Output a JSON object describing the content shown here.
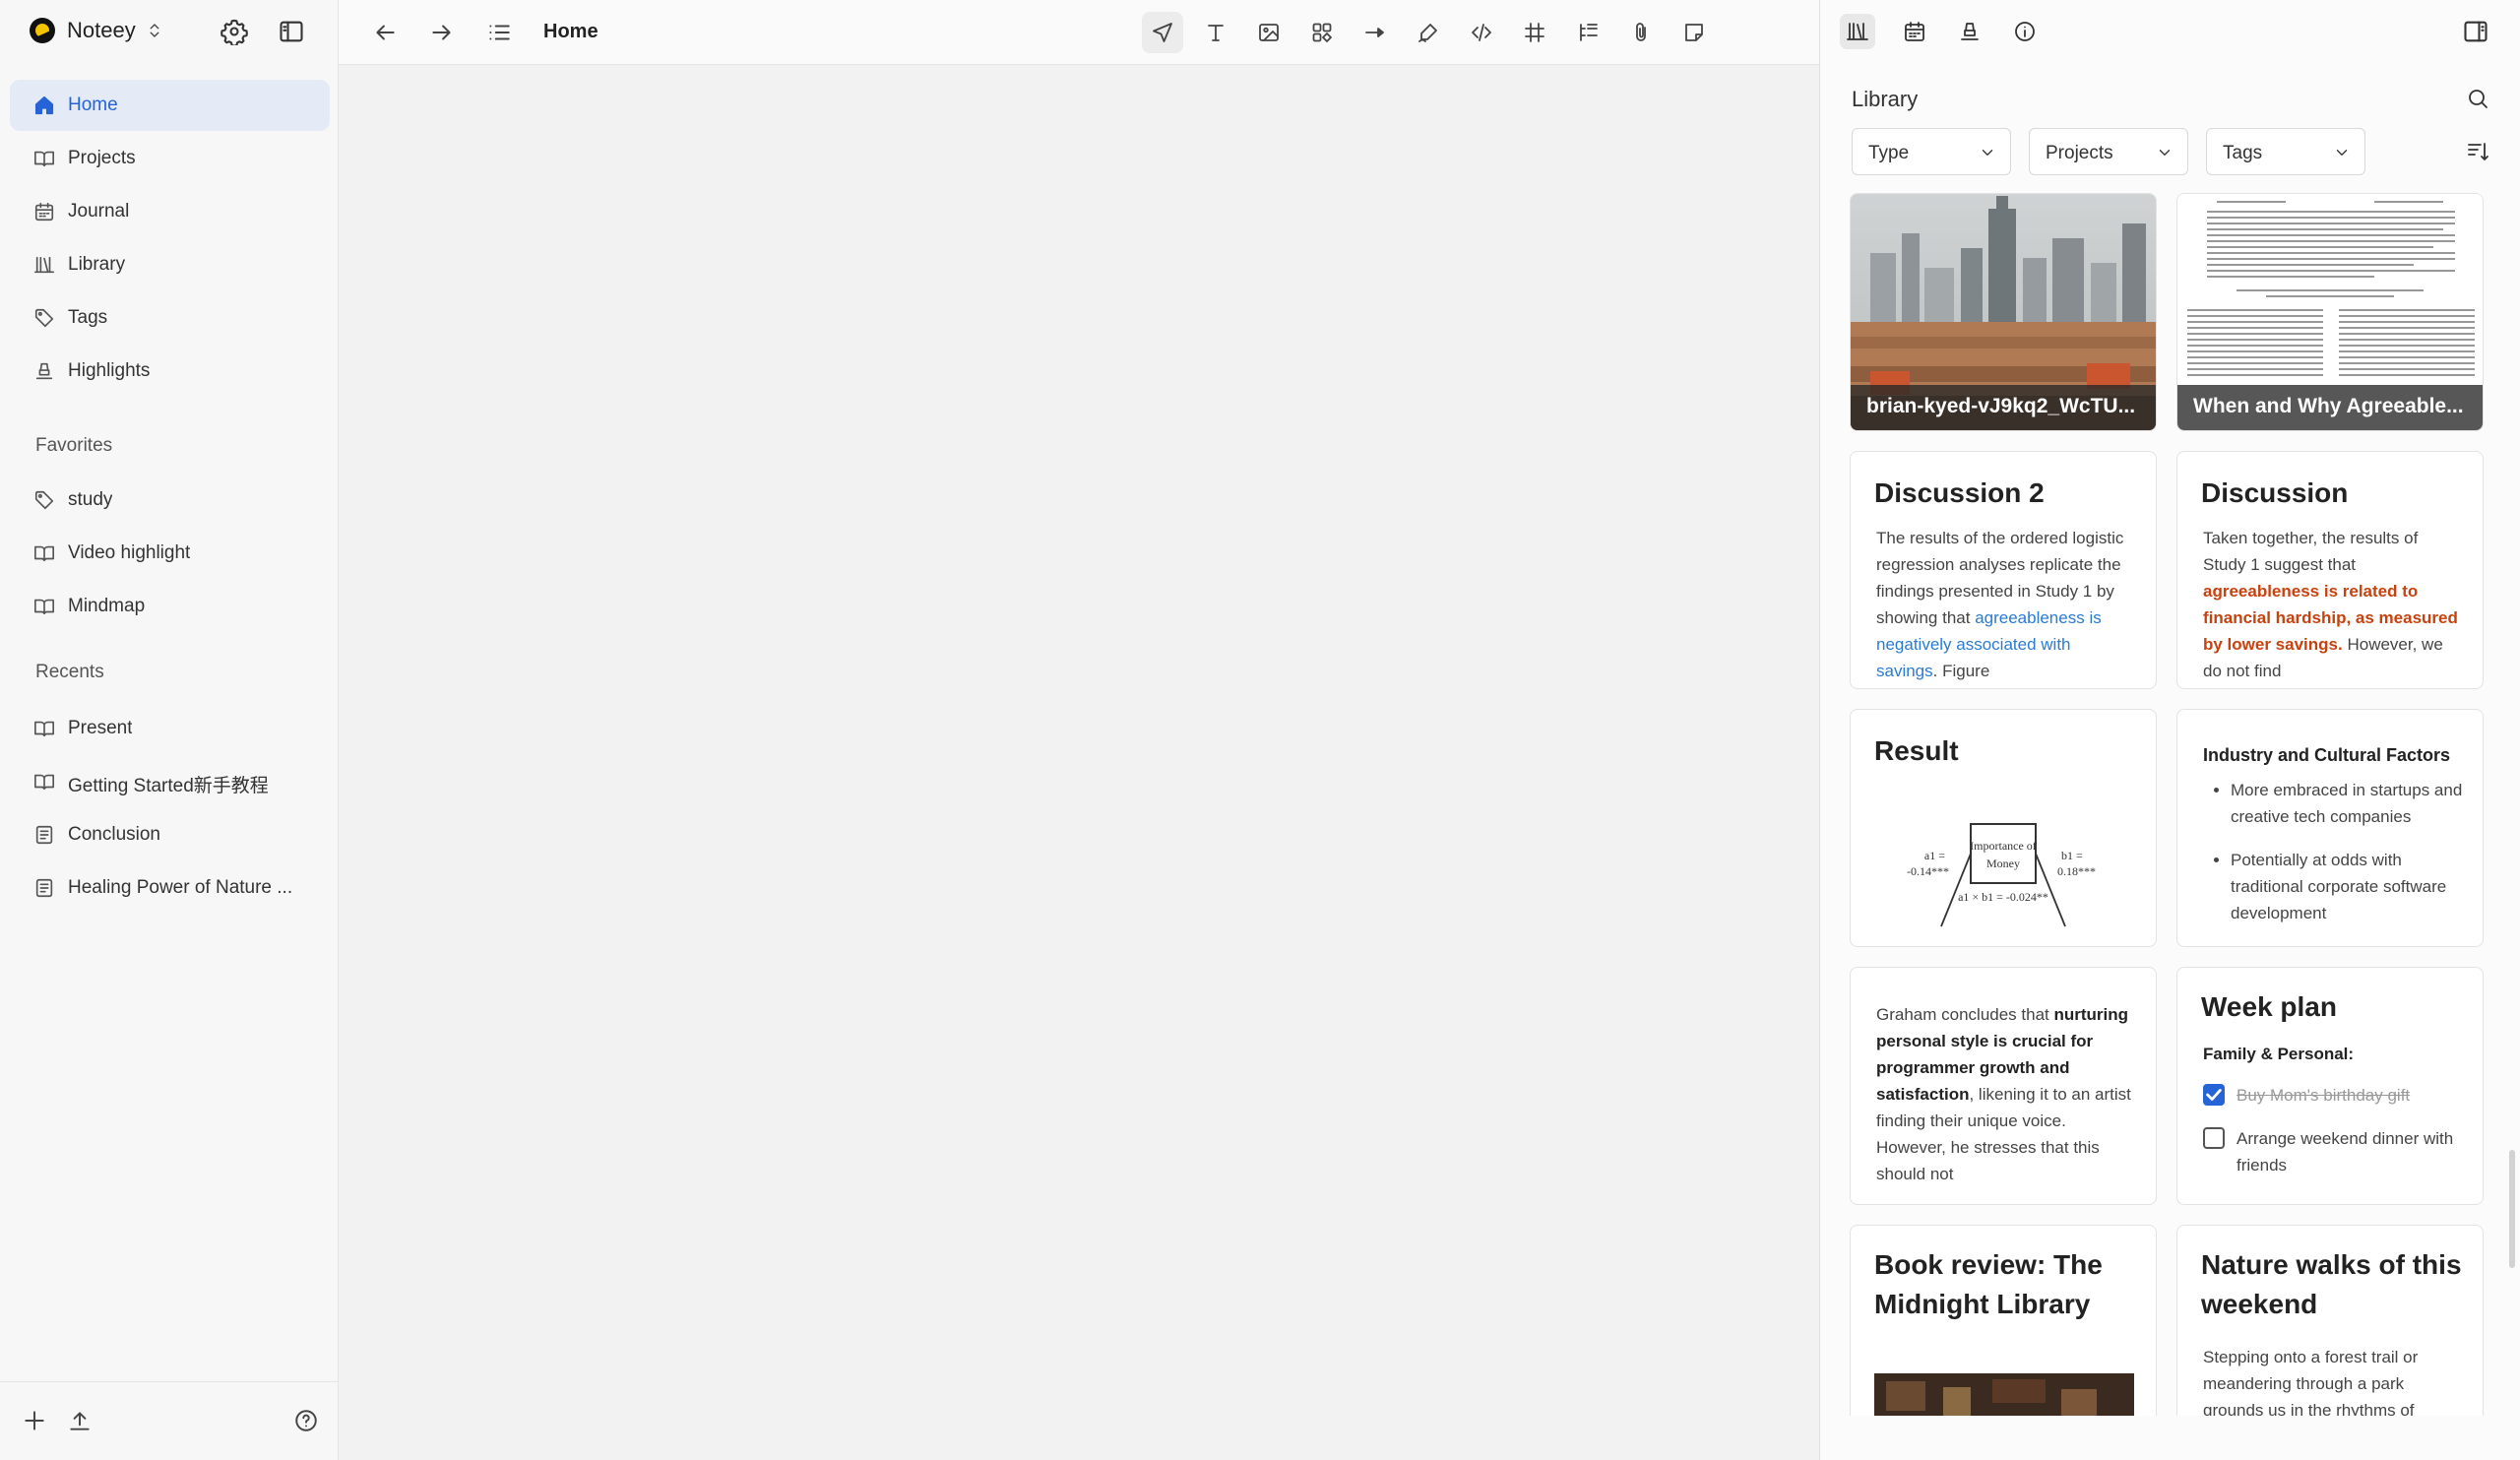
{
  "app": {
    "name": "Noteey"
  },
  "sidebar": {
    "nav": [
      {
        "label": "Home",
        "icon": "home-icon",
        "active": true
      },
      {
        "label": "Projects",
        "icon": "book-icon"
      },
      {
        "label": "Journal",
        "icon": "calendar-icon"
      },
      {
        "label": "Library",
        "icon": "library-icon"
      },
      {
        "label": "Tags",
        "icon": "tag-icon"
      },
      {
        "label": "Highlights",
        "icon": "highlighter-icon"
      }
    ],
    "favorites_title": "Favorites",
    "favorites": [
      {
        "label": "study",
        "icon": "tag-icon"
      },
      {
        "label": "Video highlight",
        "icon": "book-icon"
      },
      {
        "label": "Mindmap",
        "icon": "book-icon"
      }
    ],
    "recents_title": "Recents",
    "recents": [
      {
        "label": "Present",
        "icon": "book-icon"
      },
      {
        "label": "Getting Started新手教程",
        "icon": "book-icon"
      },
      {
        "label": "Conclusion",
        "icon": "note-icon"
      },
      {
        "label": "Healing Power of Nature ...",
        "icon": "note-icon"
      }
    ]
  },
  "main": {
    "breadcrumb": "Home",
    "toolbar": [
      "pointer-icon",
      "text-icon",
      "image-icon",
      "shapes-icon",
      "arrow-icon",
      "pen-icon",
      "code-icon",
      "frame-icon",
      "outline-icon",
      "attach-icon",
      "sticky-note-icon"
    ]
  },
  "panel": {
    "title": "Library",
    "filters": {
      "type": "Type",
      "projects": "Projects",
      "tags": "Tags"
    },
    "cards": {
      "img1": {
        "title": "brian-kyed-vJ9kq2_WcTU..."
      },
      "img2": {
        "title": "When and Why Agreeable..."
      },
      "discussion2": {
        "title": "Discussion 2",
        "text_a": "The results of the ordered logistic regression analyses replicate the findings presented in Study 1 by showing that ",
        "text_hl": "agreeableness is negatively associated with savings",
        "text_b": ". Figure"
      },
      "discussion": {
        "title": "Discussion",
        "text_a": "Taken together, the results of Study 1 suggest that ",
        "text_hl": "agreeableness is related to financial hardship, as measured by lower savings.",
        "text_b": " However, we do not find"
      },
      "result": {
        "title": "Result",
        "diagram_box_line1": "Importance of",
        "diagram_box_line2": "Money",
        "diagram_left_1": "a1 =",
        "diagram_left_2": "-0.14***",
        "diagram_right_1": "b1 =",
        "diagram_right_2": "0.18***",
        "diagram_bottom": "a1 × b1 = -0.024**"
      },
      "industry": {
        "title": "Industry and Cultural Factors",
        "bullets": [
          "More embraced in startups and creative tech companies",
          "Potentially at odds with traditional corporate software development"
        ]
      },
      "graham": {
        "text_a": "Graham concludes that ",
        "text_b": "nurturing personal style is crucial for programmer growth and satisfaction",
        "text_c": ", likening it to an artist finding their unique voice. However, he stresses that this should not"
      },
      "week": {
        "title": "Week plan",
        "subtitle": "Family & Personal:",
        "todo1": "Buy Mom's birthday gift",
        "todo2": "Arrange weekend dinner with friends"
      },
      "book": {
        "title": "Book review: The Midnight Library"
      },
      "nature": {
        "title": "Nature walks of this weekend",
        "text": "Stepping onto a forest trail or meandering through a park grounds us in the rhythms of"
      }
    }
  },
  "colors": {
    "accent": "#2563d6",
    "highlight_blue": "#2a7bd4",
    "highlight_red": "#c6420f",
    "active_bg": "#e4ebf7"
  }
}
